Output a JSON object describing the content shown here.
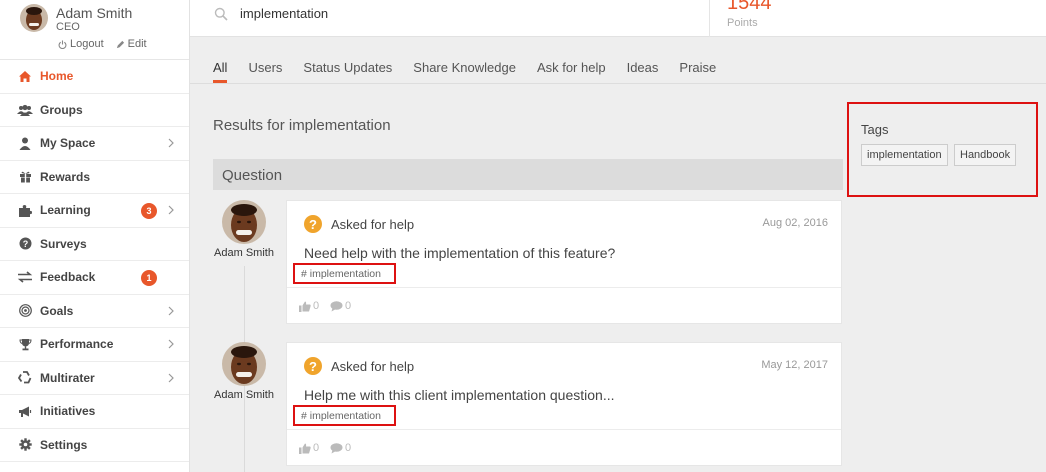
{
  "profile": {
    "name": "Adam Smith",
    "role": "CEO",
    "logout_label": "Logout",
    "edit_label": "Edit"
  },
  "sidebar": {
    "items": [
      {
        "label": "Home",
        "icon": "home-icon",
        "active": true
      },
      {
        "label": "Groups",
        "icon": "groups-icon"
      },
      {
        "label": "My Space",
        "icon": "user-icon",
        "chevron": true
      },
      {
        "label": "Rewards",
        "icon": "gift-icon"
      },
      {
        "label": "Learning",
        "icon": "puzzle-icon",
        "badge": "3",
        "chevron": true
      },
      {
        "label": "Surveys",
        "icon": "question-circle-icon"
      },
      {
        "label": "Feedback",
        "icon": "exchange-icon",
        "badge": "1"
      },
      {
        "label": "Goals",
        "icon": "target-icon",
        "chevron": true
      },
      {
        "label": "Performance",
        "icon": "trophy-icon",
        "chevron": true
      },
      {
        "label": "Multirater",
        "icon": "recycle-icon",
        "chevron": true
      },
      {
        "label": "Initiatives",
        "icon": "bullhorn-icon"
      },
      {
        "label": "Settings",
        "icon": "gear-icon"
      }
    ]
  },
  "search": {
    "value": "implementation"
  },
  "points": {
    "value": "1544",
    "label": "Points"
  },
  "tabs": [
    {
      "label": "All",
      "active": true
    },
    {
      "label": "Users"
    },
    {
      "label": "Status Updates"
    },
    {
      "label": "Share Knowledge"
    },
    {
      "label": "Ask for help"
    },
    {
      "label": "Ideas"
    },
    {
      "label": "Praise"
    }
  ],
  "results": {
    "title": "Results for implementation",
    "section": "Question"
  },
  "tags_panel": {
    "title": "Tags",
    "tags": [
      "implementation",
      "Handbook"
    ]
  },
  "posts": [
    {
      "author": "Adam Smith",
      "type": "Asked for help",
      "date": "Aug 02, 2016",
      "text": "Need help with the implementation of this feature?",
      "tag": "# implementation",
      "likes": "0",
      "comments": "0"
    },
    {
      "author": "Adam Smith",
      "type": "Asked for help",
      "date": "May 12, 2017",
      "text": "Help me with this client implementation question...",
      "tag": "# implementation",
      "likes": "0",
      "comments": "0"
    }
  ],
  "colors": {
    "accent": "#e8572b",
    "highlight_border": "#dd1111",
    "question_icon": "#f0a42c"
  }
}
